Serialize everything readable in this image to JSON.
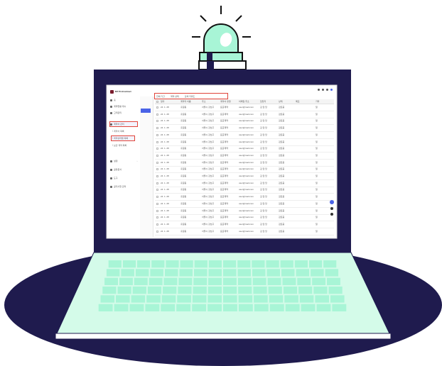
{
  "colors": {
    "laptop_navy": "#1f1b4e",
    "mint": "#a8f5d6",
    "mint_light": "#d4fbe9",
    "accent_blue": "#4a63e7",
    "highlight_red": "#e0443a"
  },
  "screen": {
    "app_name": "MY ProContract",
    "sidebar": {
      "items": [
        {
          "label": "홈"
        },
        {
          "label": "계약현황 대시"
        },
        {
          "label": "고객관리"
        },
        {
          "label": "계약서 관리"
        },
        {
          "label": "설정"
        },
        {
          "label": "공유문서"
        },
        {
          "label": "도구"
        },
        {
          "label": "공지사항 관리"
        }
      ],
      "sub_items": [
        {
          "label": "└ 계약서 목록"
        },
        {
          "label": "└ 계약상태별 목록"
        },
        {
          "label": "└ 보관 계약 목록"
        }
      ]
    },
    "toolbar": {
      "filters": [
        "전체 기간",
        "계약 상태",
        "검색 키워드"
      ]
    },
    "table": {
      "headers": [
        "일자",
        "계약자 이름",
        "주소",
        "계약서 유형",
        "이메일 주소",
        "담당자",
        "상태",
        "메모",
        "기타"
      ],
      "rows": [
        [
          "24. 1. 28",
          "홍길동",
          "서울시 강남구",
          "표준계약",
          "user@mail.com",
          "김 담 당",
          "검토중",
          "",
          "일"
        ],
        [
          "24. 1. 28",
          "홍길동",
          "서울시 강남구",
          "표준계약",
          "user@mail.com",
          "김 담 당",
          "검토중",
          "",
          "일"
        ],
        [
          "24. 1. 28",
          "홍길동",
          "서울시 강남구",
          "표준계약",
          "user@mail.com",
          "김 담 당",
          "검토중",
          "",
          "일"
        ],
        [
          "24. 1. 28",
          "홍길동",
          "서울시 강남구",
          "표준계약",
          "user@mail.com",
          "김 담 당",
          "검토중",
          "",
          "일"
        ],
        [
          "24. 1. 28",
          "홍길동",
          "서울시 강남구",
          "표준계약",
          "user@mail.com",
          "김 담 당",
          "검토중",
          "",
          "일"
        ],
        [
          "24. 1. 28",
          "홍길동",
          "서울시 강남구",
          "표준계약",
          "user@mail.com",
          "김 담 당",
          "검토중",
          "",
          "일"
        ],
        [
          "24. 1. 28",
          "홍길동",
          "서울시 강남구",
          "표준계약",
          "user@mail.com",
          "김 담 당",
          "검토중",
          "",
          "일"
        ],
        [
          "24. 1. 28",
          "홍길동",
          "서울시 강남구",
          "표준계약",
          "user@mail.com",
          "김 담 당",
          "검토중",
          "",
          "일"
        ],
        [
          "24. 1. 28",
          "홍길동",
          "서울시 강남구",
          "표준계약",
          "user@mail.com",
          "김 담 당",
          "검토중",
          "",
          "일"
        ],
        [
          "24. 1. 28",
          "홍길동",
          "서울시 강남구",
          "표준계약",
          "user@mail.com",
          "김 담 당",
          "검토중",
          "",
          "일"
        ],
        [
          "24. 1. 28",
          "홍길동",
          "서울시 강남구",
          "표준계약",
          "user@mail.com",
          "김 담 당",
          "검토중",
          "",
          "일"
        ],
        [
          "24. 1. 28",
          "홍길동",
          "서울시 강남구",
          "표준계약",
          "user@mail.com",
          "김 담 당",
          "검토중",
          "",
          "일"
        ],
        [
          "24. 1. 28",
          "홍길동",
          "서울시 강남구",
          "표준계약",
          "user@mail.com",
          "김 담 당",
          "검토중",
          "",
          "일"
        ],
        [
          "24. 1. 28",
          "홍길동",
          "서울시 강남구",
          "표준계약",
          "user@mail.com",
          "김 담 당",
          "검토중",
          "",
          "일"
        ],
        [
          "24. 1. 28",
          "홍길동",
          "서울시 강남구",
          "표준계약",
          "user@mail.com",
          "김 담 당",
          "검토중",
          "",
          "일"
        ],
        [
          "24. 1. 28",
          "홍길동",
          "서울시 강남구",
          "표준계약",
          "user@mail.com",
          "김 담 당",
          "검토중",
          "",
          "일"
        ],
        [
          "24. 1. 28",
          "홍길동",
          "서울시 강남구",
          "표준계약",
          "user@mail.com",
          "김 담 당",
          "검토중",
          "",
          "일"
        ],
        [
          "24. 1. 28",
          "홍길동",
          "서울시 강남구",
          "표준계약",
          "user@mail.com",
          "김 담 당",
          "검토중",
          "",
          "일"
        ],
        [
          "24. 1. 28",
          "홍길동",
          "서울시 강남구",
          "표준계약",
          "user@mail.com",
          "김 담 당",
          "검토중",
          "",
          "일"
        ]
      ]
    }
  }
}
